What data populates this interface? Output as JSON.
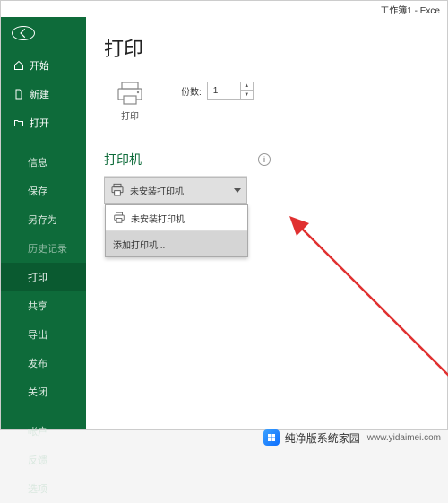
{
  "titlebar": "工作簿1 - Exce",
  "page_title": "打印",
  "print_tile_label": "打印",
  "copies_label": "份数:",
  "copies_value": "1",
  "section_printer": "打印机",
  "printer_selected": "未安装打印机",
  "dropdown": {
    "opt_none": "未安装打印机",
    "opt_add": "添加打印机..."
  },
  "sidebar": {
    "start": "开始",
    "new": "新建",
    "open": "打开",
    "info": "信息",
    "save": "保存",
    "saveas": "另存为",
    "history": "历史记录",
    "print": "打印",
    "share": "共享",
    "export": "导出",
    "publish": "发布",
    "close": "关闭",
    "account": "帐户",
    "feedback": "反馈",
    "options": "选项"
  },
  "watermark": {
    "name": "纯净版系统家园",
    "url": "www.yidaimei.com"
  }
}
